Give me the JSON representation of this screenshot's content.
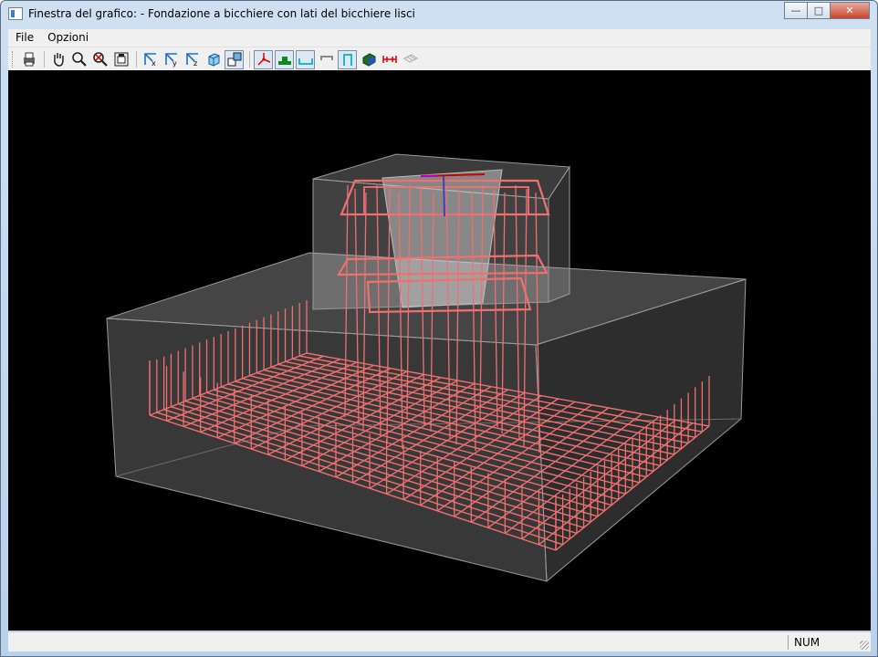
{
  "window": {
    "title": "Finestra del grafico: - Fondazione a bicchiere con lati del bicchiere lisci"
  },
  "menu": {
    "items": [
      "File",
      "Opzioni"
    ]
  },
  "toolbar": {
    "buttons": [
      "print-icon",
      "pan-hand-icon",
      "zoom-icon",
      "zoom-reset-icon",
      "fit-view-icon",
      "view-x-icon",
      "view-y-icon",
      "view-z-icon",
      "view-3d-icon",
      "perspective-icon",
      "axes-icon",
      "section-icon",
      "base-icon",
      "hook-icon",
      "stirrup-icon",
      "render-icon",
      "dimension-icon",
      "grid-icon"
    ]
  },
  "status": {
    "num": "NUM"
  },
  "colors": {
    "rebar": "#f07070",
    "concrete_edge": "#9a9a9a",
    "viewport_bg": "#000000"
  }
}
